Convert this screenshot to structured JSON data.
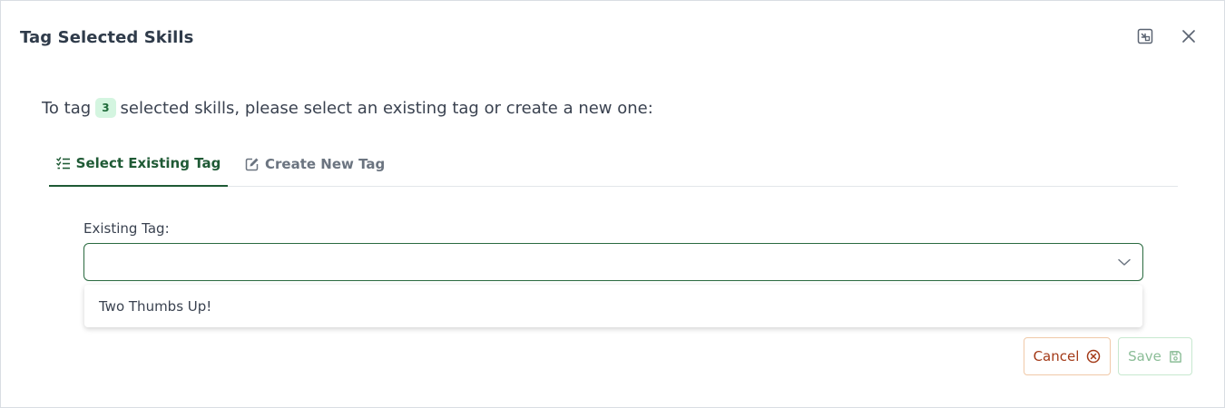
{
  "dialog": {
    "title": "Tag Selected Skills"
  },
  "intro": {
    "prefix": "To tag",
    "count": "3",
    "suffix": "selected skills, please select an existing tag or create a new one:"
  },
  "tabs": [
    {
      "label": "Select Existing Tag",
      "icon": "checklist-icon",
      "active": true
    },
    {
      "label": "Create New Tag",
      "icon": "edit-icon",
      "active": false
    }
  ],
  "field": {
    "label": "Existing Tag:",
    "value": ""
  },
  "dropdown": {
    "options": [
      "Two Thumbs Up!"
    ]
  },
  "buttons": {
    "cancel": "Cancel",
    "save": "Save"
  },
  "colors": {
    "accent": "#1f5a35",
    "badge_bg": "#d4f5e0",
    "cancel": "#a33a18",
    "save_disabled": "#8bbd97"
  }
}
